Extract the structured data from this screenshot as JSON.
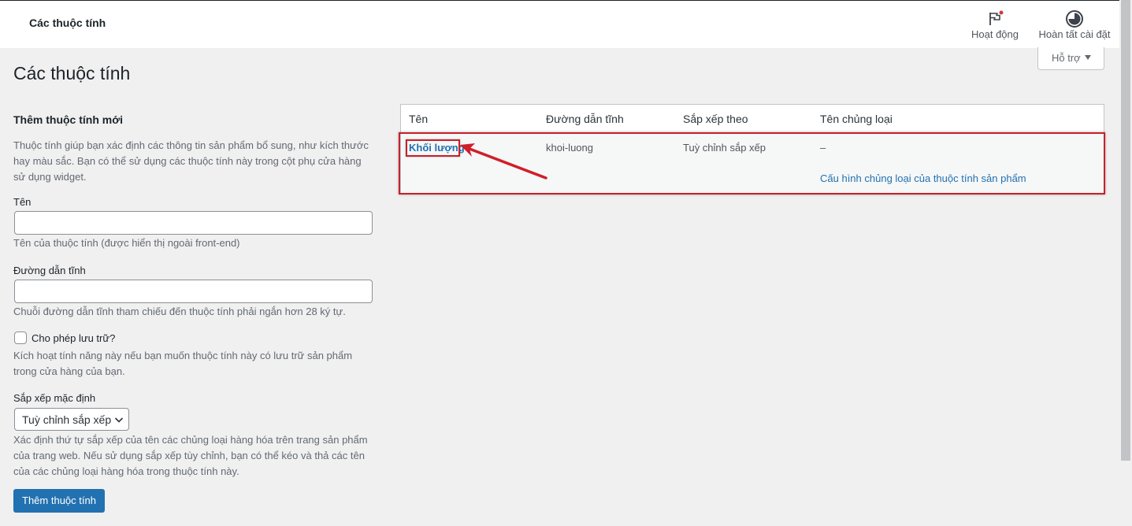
{
  "header": {
    "title": "Các thuộc tính",
    "activity_label": "Hoạt động",
    "setup_label": "Hoàn tất cài đặt",
    "help_label": "Hỗ trợ",
    "accent_dot_color": "#d63638"
  },
  "page": {
    "title": "Các thuộc tính"
  },
  "form": {
    "heading": "Thêm thuộc tính mới",
    "intro": "Thuộc tính giúp bạn xác định các thông tin sản phẩm bổ sung, như kích thước hay màu sắc. Bạn có thể sử dụng các thuộc tính này trong cột phụ cửa hàng sử dụng widget.",
    "name_label": "Tên",
    "name_value": "",
    "name_help": "Tên của thuộc tính (được hiển thị ngoài front-end)",
    "slug_label": "Đường dẫn tĩnh",
    "slug_value": "",
    "slug_help": "Chuỗi đường dẫn tĩnh tham chiếu đến thuộc tính phải ngắn hơn 28 ký tự.",
    "archive_label": "Cho phép lưu trữ?",
    "archive_checked": false,
    "archive_help": "Kích hoạt tính năng này nếu bạn muốn thuộc tính này có lưu trữ sản phẩm trong cửa hàng của bạn.",
    "orderby_label": "Sắp xếp mặc định",
    "orderby_selected": "Tuỳ chỉnh sắp xếp",
    "orderby_help": "Xác định thứ tự sắp xếp của tên các chủng loại hàng hóa trên trang sản phẩm của trang web. Nếu sử dụng sắp xếp tùy chỉnh, bạn có thể kéo và thả các tên của các chủng loại hàng hóa trong thuộc tính này.",
    "submit_label": "Thêm thuộc tính"
  },
  "table": {
    "columns": [
      "Tên",
      "Đường dẫn tĩnh",
      "Sắp xếp theo",
      "Tên chủng loại"
    ],
    "rows": [
      {
        "name": "Khối lượng",
        "slug": "khoi-luong",
        "orderby": "Tuỳ chỉnh sắp xếp",
        "terms": "–",
        "configure_link": "Cấu hình chủng loại của thuộc tính sản phẩm"
      }
    ]
  },
  "annotation": {
    "color": "#c8202a",
    "arrow_icon": "red-arrow"
  }
}
